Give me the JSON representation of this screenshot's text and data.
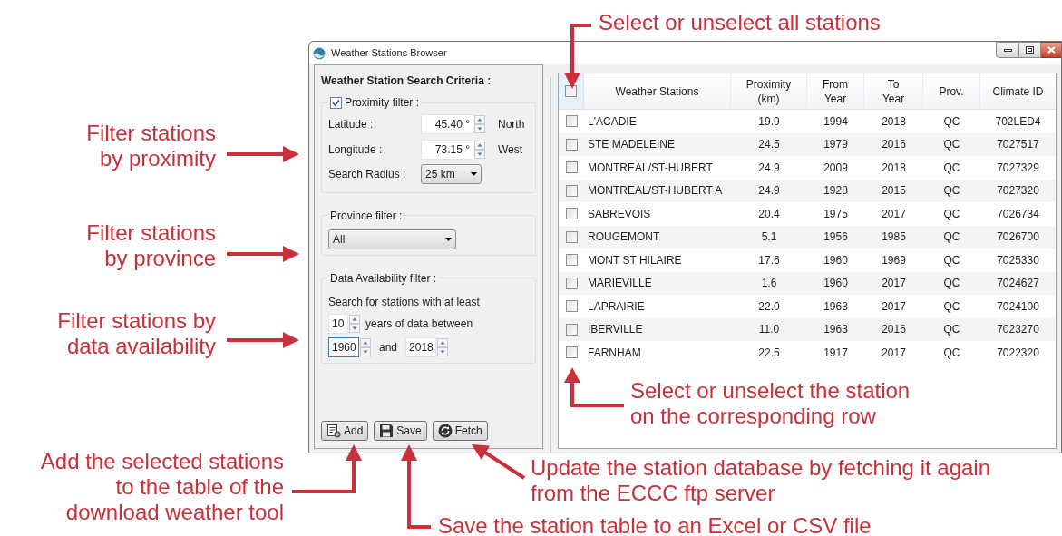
{
  "window": {
    "title": "Weather Stations Browser"
  },
  "search_panel": {
    "heading": "Weather Station Search Criteria :",
    "proximity_filter": {
      "label": "Proximity filter :",
      "checked": true,
      "fields": [
        {
          "label": "Latitude :",
          "value": "45.40 °",
          "unit": "North"
        },
        {
          "label": "Longitude :",
          "value": "73.15 °",
          "unit": "West"
        }
      ],
      "radius": {
        "label": "Search Radius :",
        "value": "25 km"
      }
    },
    "province_filter": {
      "label": "Province filter :",
      "value": "All"
    },
    "data_filter": {
      "label": "Data Availability filter :",
      "intro": "Search for stations with at least",
      "years": "10",
      "years_label": "years of data between",
      "from": {
        "value": "1960",
        "focused": true
      },
      "and": "and",
      "to": {
        "value": "2018",
        "focused": false
      }
    },
    "buttons": [
      {
        "kind": "add",
        "label": "Add"
      },
      {
        "kind": "save",
        "label": "Save"
      },
      {
        "kind": "fetch",
        "label": "Fetch"
      }
    ]
  },
  "table": {
    "select_all_checked": false,
    "columns": [
      "Weather Stations",
      "Proximity (km)",
      "From Year",
      "To Year",
      "Prov.",
      "Climate ID"
    ],
    "rows": [
      {
        "checked": false,
        "cells": [
          "L'ACADIE",
          "19.9",
          "1994",
          "2018",
          "QC",
          "702LED4"
        ]
      },
      {
        "checked": false,
        "cells": [
          "STE MADELEINE",
          "24.5",
          "1979",
          "2016",
          "QC",
          "7027517"
        ]
      },
      {
        "checked": false,
        "cells": [
          "MONTREAL/ST-HUBERT",
          "24.9",
          "2009",
          "2018",
          "QC",
          "7027329"
        ]
      },
      {
        "checked": false,
        "cells": [
          "MONTREAL/ST-HUBERT A",
          "24.9",
          "1928",
          "2015",
          "QC",
          "7027320"
        ]
      },
      {
        "checked": false,
        "cells": [
          "SABREVOIS",
          "20.4",
          "1975",
          "2017",
          "QC",
          "7026734"
        ]
      },
      {
        "checked": false,
        "cells": [
          "ROUGEMONT",
          "5.1",
          "1956",
          "1985",
          "QC",
          "7026700"
        ]
      },
      {
        "checked": false,
        "cells": [
          "MONT ST HILAIRE",
          "17.6",
          "1960",
          "1969",
          "QC",
          "7025330"
        ]
      },
      {
        "checked": false,
        "cells": [
          "MARIEVILLE",
          "1.6",
          "1960",
          "2017",
          "QC",
          "7024627"
        ]
      },
      {
        "checked": false,
        "cells": [
          "LAPRAIRIE",
          "22.0",
          "1963",
          "2017",
          "QC",
          "7024100"
        ]
      },
      {
        "checked": false,
        "cells": [
          "IBERVILLE",
          "11.0",
          "1963",
          "2016",
          "QC",
          "7023270"
        ]
      },
      {
        "checked": false,
        "cells": [
          "FARNHAM",
          "22.5",
          "1917",
          "2017",
          "QC",
          "7022320"
        ]
      }
    ]
  },
  "annotations": [
    {
      "kind": "select-all",
      "lines": [
        "Select or unselect all stations"
      ]
    },
    {
      "kind": "proximity",
      "lines": [
        "Filter stations",
        "by proximity"
      ]
    },
    {
      "kind": "province",
      "lines": [
        "Filter stations",
        "by province"
      ]
    },
    {
      "kind": "data",
      "lines": [
        "Filter stations by",
        "data availability"
      ]
    },
    {
      "kind": "select-row",
      "lines": [
        "Select or unselect the station",
        "on the corresponding row"
      ]
    },
    {
      "kind": "add",
      "lines": [
        "Add the selected stations",
        "to the table of the",
        "download weather tool"
      ]
    },
    {
      "kind": "save",
      "lines": [
        "Save the station table to an Excel or CSV file"
      ]
    },
    {
      "kind": "fetch",
      "lines": [
        "Update the station database by fetching it again",
        "from the ECCC ftp server"
      ]
    }
  ]
}
